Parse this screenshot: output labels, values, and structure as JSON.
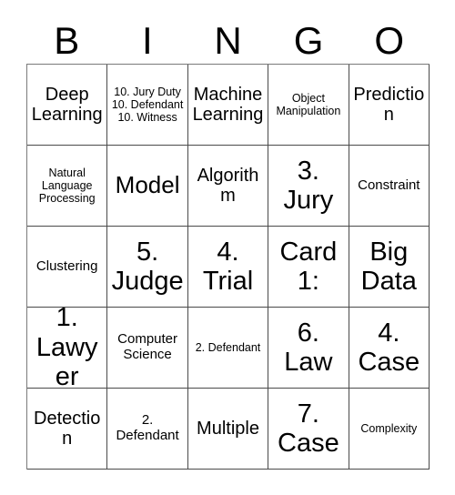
{
  "card": {
    "header_letters": [
      "B",
      "I",
      "N",
      "G",
      "O"
    ],
    "columns": 5,
    "rows": 5,
    "border_color": "#4a4a4a",
    "background_color": "#ffffff",
    "text_color": "#000000"
  },
  "cells": [
    {
      "text": "Deep Learning",
      "size": "md"
    },
    {
      "text": "10. Jury Duty 10. Defendant 10. Witness",
      "size": "xs"
    },
    {
      "text": "Machine Learning",
      "size": "md"
    },
    {
      "text": "Object Manipulation",
      "size": "xs"
    },
    {
      "text": "Prediction",
      "size": "md"
    },
    {
      "text": "Natural Language Processing",
      "size": "xs"
    },
    {
      "text": "Model",
      "size": "lg"
    },
    {
      "text": "Algorithm",
      "size": "md"
    },
    {
      "text": "3. Jury",
      "size": "xl"
    },
    {
      "text": "Constraint",
      "size": "sm"
    },
    {
      "text": "Clustering",
      "size": "sm"
    },
    {
      "text": "5. Judge",
      "size": "xl"
    },
    {
      "text": "4. Trial",
      "size": "xl"
    },
    {
      "text": "Card 1:",
      "size": "xl"
    },
    {
      "text": "Big Data",
      "size": "xl"
    },
    {
      "text": "1. Lawyer",
      "size": "xl"
    },
    {
      "text": "Computer Science",
      "size": "sm"
    },
    {
      "text": "2. Defendant",
      "size": "xs"
    },
    {
      "text": "6. Law",
      "size": "xl"
    },
    {
      "text": "4. Case",
      "size": "xl"
    },
    {
      "text": "Detection",
      "size": "md"
    },
    {
      "text": "2. Defendant",
      "size": "sm"
    },
    {
      "text": "Multiple",
      "size": "md"
    },
    {
      "text": "7. Case",
      "size": "xl"
    },
    {
      "text": "Complexity",
      "size": "xs"
    }
  ]
}
